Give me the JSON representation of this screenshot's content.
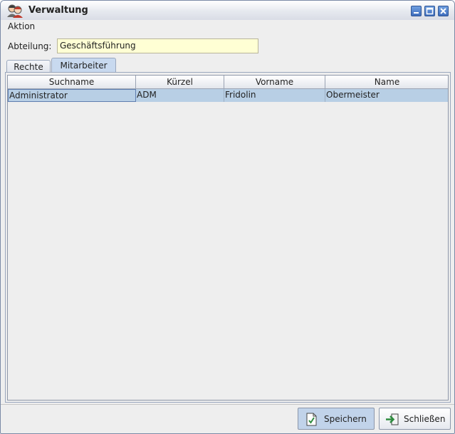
{
  "window": {
    "title": "Verwaltung",
    "buttons": [
      "minimize",
      "maximize",
      "close"
    ]
  },
  "menubar": {
    "items": [
      {
        "label": "Aktion"
      }
    ]
  },
  "form": {
    "abteilung_label": "Abteilung:",
    "abteilung_value": "Geschäftsführung"
  },
  "tabs": [
    {
      "label": "Rechte",
      "selected": false
    },
    {
      "label": "Mitarbeiter",
      "selected": true
    }
  ],
  "table": {
    "columns": [
      "Suchname",
      "Kürzel",
      "Vorname",
      "Name"
    ],
    "rows": [
      {
        "suchname": "Administrator",
        "kuerzel": "ADM",
        "vorname": "Fridolin",
        "name": "Obermeister",
        "selected": true
      }
    ]
  },
  "footer": {
    "save_label": "Speichern",
    "close_label": "Schließen"
  },
  "colors": {
    "input_background": "#ffffd4",
    "selection": "#b8cfe5",
    "title_button": "#4a7acc"
  },
  "icons": {
    "app": "users-icon",
    "save": "document-check-icon",
    "close": "exit-arrow-icon"
  }
}
